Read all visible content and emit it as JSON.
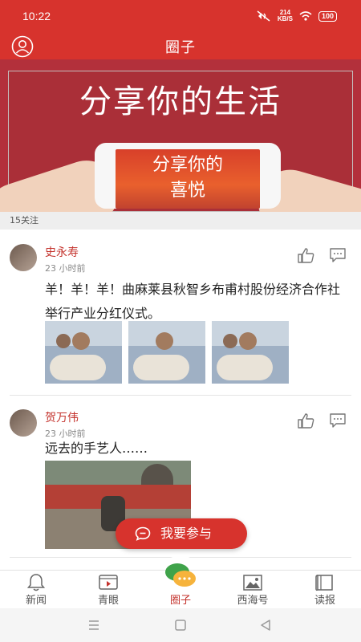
{
  "status": {
    "time": "10:22",
    "speed_value": "214",
    "speed_unit": "KB/S",
    "battery": "100"
  },
  "header": {
    "title": "圈子"
  },
  "banner": {
    "slogan": "分享你的生活",
    "phone_slogan_line1": "分享你的",
    "phone_slogan_line2": "喜悦"
  },
  "follow": {
    "text": "15关注"
  },
  "posts": [
    {
      "author": "史永寿",
      "time": "23 小时前",
      "text": "羊！羊！羊！曲麻莱县秋智乡布甫村股份经济合作社举行产业分红仪式。"
    },
    {
      "author": "贺万伟",
      "time": "23 小时前",
      "text": "远去的手艺人……"
    }
  ],
  "join_button": {
    "label": "我要参与"
  },
  "tabs": [
    {
      "label": "新闻",
      "icon": "bell-icon"
    },
    {
      "label": "青眼",
      "icon": "video-icon"
    },
    {
      "label": "圈子",
      "icon": "chat-bubbles-icon"
    },
    {
      "label": "西海号",
      "icon": "picture-icon"
    },
    {
      "label": "读报",
      "icon": "book-icon"
    }
  ],
  "colors": {
    "brand": "#d7332d"
  }
}
